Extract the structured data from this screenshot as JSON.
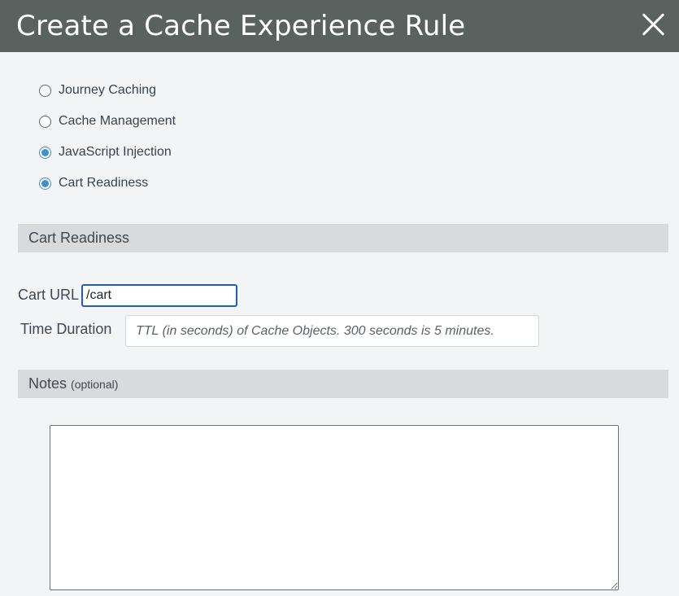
{
  "dialog": {
    "title": "Create a Cache Experience Rule",
    "close_icon": "close-icon"
  },
  "rule_types": [
    {
      "label": "Journey Caching",
      "checked": false
    },
    {
      "label": "Cache Management",
      "checked": false
    },
    {
      "label": "JavaScript Injection",
      "checked": true
    },
    {
      "label": "Cart Readiness",
      "checked": true
    }
  ],
  "cart_section": {
    "heading": "Cart Readiness",
    "cart_url_label": "Cart URL",
    "cart_url_value": "/cart",
    "time_duration_label": "Time Duration",
    "time_duration_placeholder": "TTL (in seconds) of Cache Objects. 300 seconds is 5 minutes.",
    "time_duration_value": ""
  },
  "notes_section": {
    "heading": "Notes",
    "optional_label": "(optional)",
    "value": ""
  },
  "colors": {
    "titlebar": "#59625f",
    "accent": "#3e8ed0",
    "focus_border": "#1d5fb6",
    "section_bar": "#d9dadc",
    "background": "#f3f4f6"
  }
}
